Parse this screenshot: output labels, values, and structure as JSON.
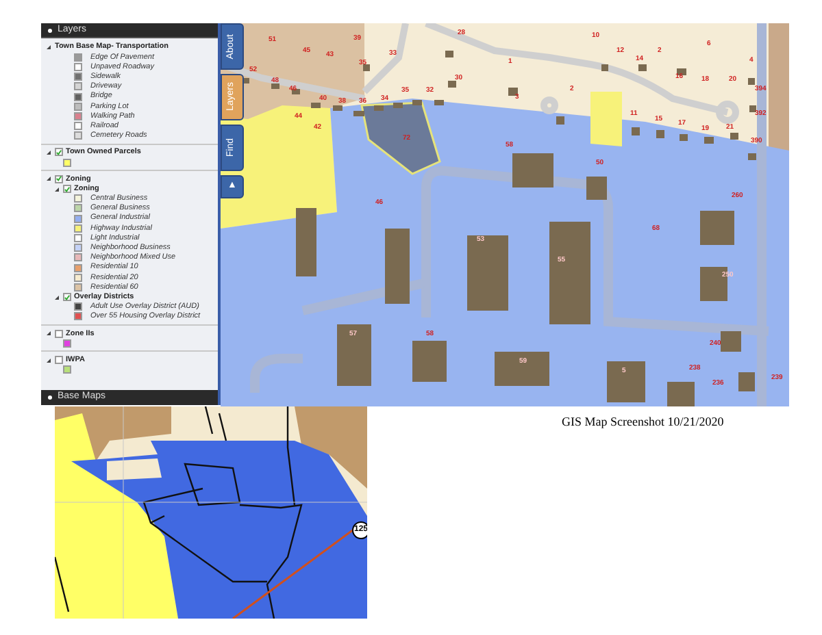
{
  "layers_panel": {
    "title": "Layers",
    "groups": [
      {
        "label": "Town Base Map- Transportation",
        "expanded": true,
        "legend": [
          {
            "label": "Edge Of Pavement",
            "color": "#9a9a9a"
          },
          {
            "label": "Unpaved Roadway",
            "color": "#ffffff"
          },
          {
            "label": "Sidewalk",
            "color": "#707070"
          },
          {
            "label": "Driveway",
            "color": "#d4d4d4"
          },
          {
            "label": "Bridge",
            "color": "#606060"
          },
          {
            "label": "Parking Lot",
            "color": "#bdbdbd"
          },
          {
            "label": "Walking Path",
            "color": "#d9808e"
          },
          {
            "label": "Railroad",
            "color": "#ffffff"
          },
          {
            "label": "Cemetery Roads",
            "color": "#dcdcdc"
          }
        ]
      },
      {
        "label": "Town Owned Parcels",
        "expanded": true,
        "checked": true,
        "legend": [
          {
            "color": "#ffff66"
          }
        ]
      },
      {
        "label": "Zoning",
        "expanded": true,
        "checked": true,
        "children": [
          {
            "label": "Zoning",
            "expanded": true,
            "checked": true,
            "legend": [
              {
                "label": "Central Business",
                "color": "#f4f4dc"
              },
              {
                "label": "General Business",
                "color": "#bcd5a8"
              },
              {
                "label": "General Industrial",
                "color": "#94aef0"
              },
              {
                "label": "Highway Industrial",
                "color": "#f7f27a"
              },
              {
                "label": "Light Industrial",
                "color": "#ffffff"
              },
              {
                "label": "Neighborhood Business",
                "color": "#c4d2f7"
              },
              {
                "label": "Neighborhood Mixed Use",
                "color": "#e8b8b8"
              },
              {
                "label": "Residential 10",
                "color": "#e8a06c"
              },
              {
                "label": "Residential 20",
                "color": "#f6ebcf"
              },
              {
                "label": "Residential 60",
                "color": "#dcc3a5"
              }
            ]
          },
          {
            "label": "Overlay Districts",
            "expanded": true,
            "checked": true,
            "legend": [
              {
                "label": "Adult Use Overlay District (AUD)",
                "color": "#444444"
              },
              {
                "label": "Over 55 Housing Overlay District",
                "color": "#e05050"
              }
            ]
          }
        ]
      },
      {
        "label": "Zone IIs",
        "expanded": true,
        "checked": false,
        "legend": [
          {
            "color": "#e040e0"
          }
        ]
      },
      {
        "label": "IWPA",
        "expanded": true,
        "checked": false,
        "legend": [
          {
            "color": "#b8e07a"
          }
        ]
      }
    ],
    "footer": "Base Maps"
  },
  "side_tabs": [
    {
      "label": "About",
      "selected": false
    },
    {
      "label": "Layers",
      "selected": true
    },
    {
      "label": "Find",
      "selected": false
    },
    {
      "label": "▲",
      "selected": false
    }
  ],
  "map": {
    "parcel_numbers": [
      "51",
      "45",
      "43",
      "39",
      "35",
      "33",
      "28",
      "30",
      "1",
      "10",
      "12",
      "14",
      "2",
      "6",
      "4",
      "52",
      "48",
      "46",
      "40",
      "38",
      "36",
      "34",
      "35",
      "32",
      "2",
      "3",
      "16",
      "18",
      "20",
      "394",
      "11",
      "15",
      "17",
      "19",
      "21",
      "392",
      "390",
      "44",
      "42",
      "58",
      "72",
      "50",
      "260",
      "46",
      "53",
      "55",
      "68",
      "250",
      "57",
      "58",
      "59",
      "5",
      "240",
      "238",
      "236",
      "239"
    ]
  },
  "inset_map": {
    "route_shield": "125"
  },
  "caption": "GIS Map Screenshot 10/21/2020"
}
